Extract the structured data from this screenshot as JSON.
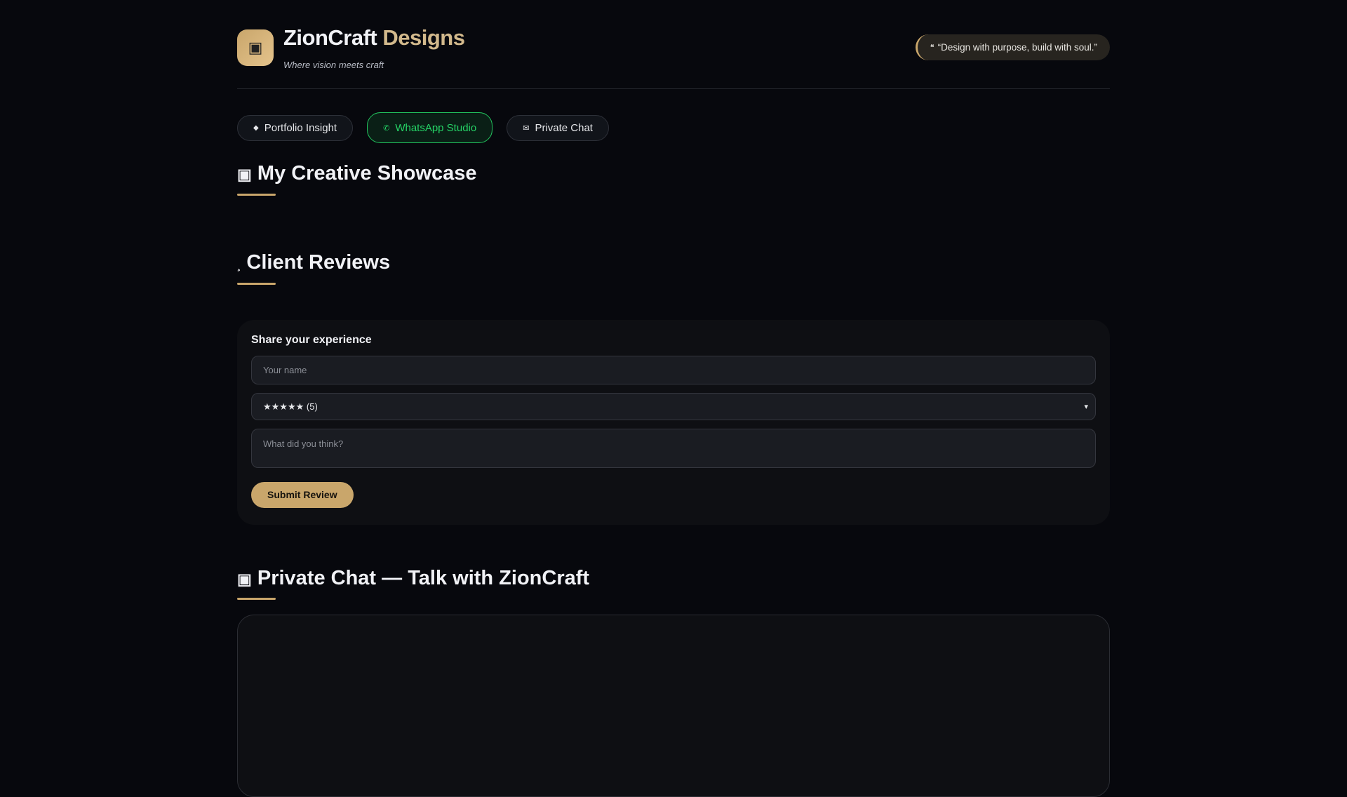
{
  "header": {
    "logo_icon": "▣",
    "brand_main": "ZionCraft",
    "brand_accent": "Designs",
    "tagline": "Where vision meets craft",
    "quote_icon": "❝",
    "quote": "“Design with purpose, build with soul.”"
  },
  "tabs": [
    {
      "icon": "◆",
      "label": "Portfolio Insight"
    },
    {
      "icon": "✆",
      "label": "WhatsApp Studio"
    },
    {
      "icon": "✉",
      "label": "Private Chat"
    }
  ],
  "sections": {
    "showcase": {
      "icon": "▣",
      "title": "My Creative Showcase"
    },
    "reviews": {
      "icon": "¸",
      "title": "Client Reviews"
    },
    "chat": {
      "icon": "▣",
      "title": "Private Chat — Talk with ZionCraft"
    }
  },
  "review_form": {
    "heading": "Share your experience",
    "name_placeholder": "Your name",
    "rating_selected": "★★★★★ (5)",
    "comment_placeholder": "What did you think?",
    "submit_label": "Submit Review"
  },
  "colors": {
    "accent": "#c9a66b",
    "whatsapp": "#25d366",
    "bg": "#07080d"
  }
}
